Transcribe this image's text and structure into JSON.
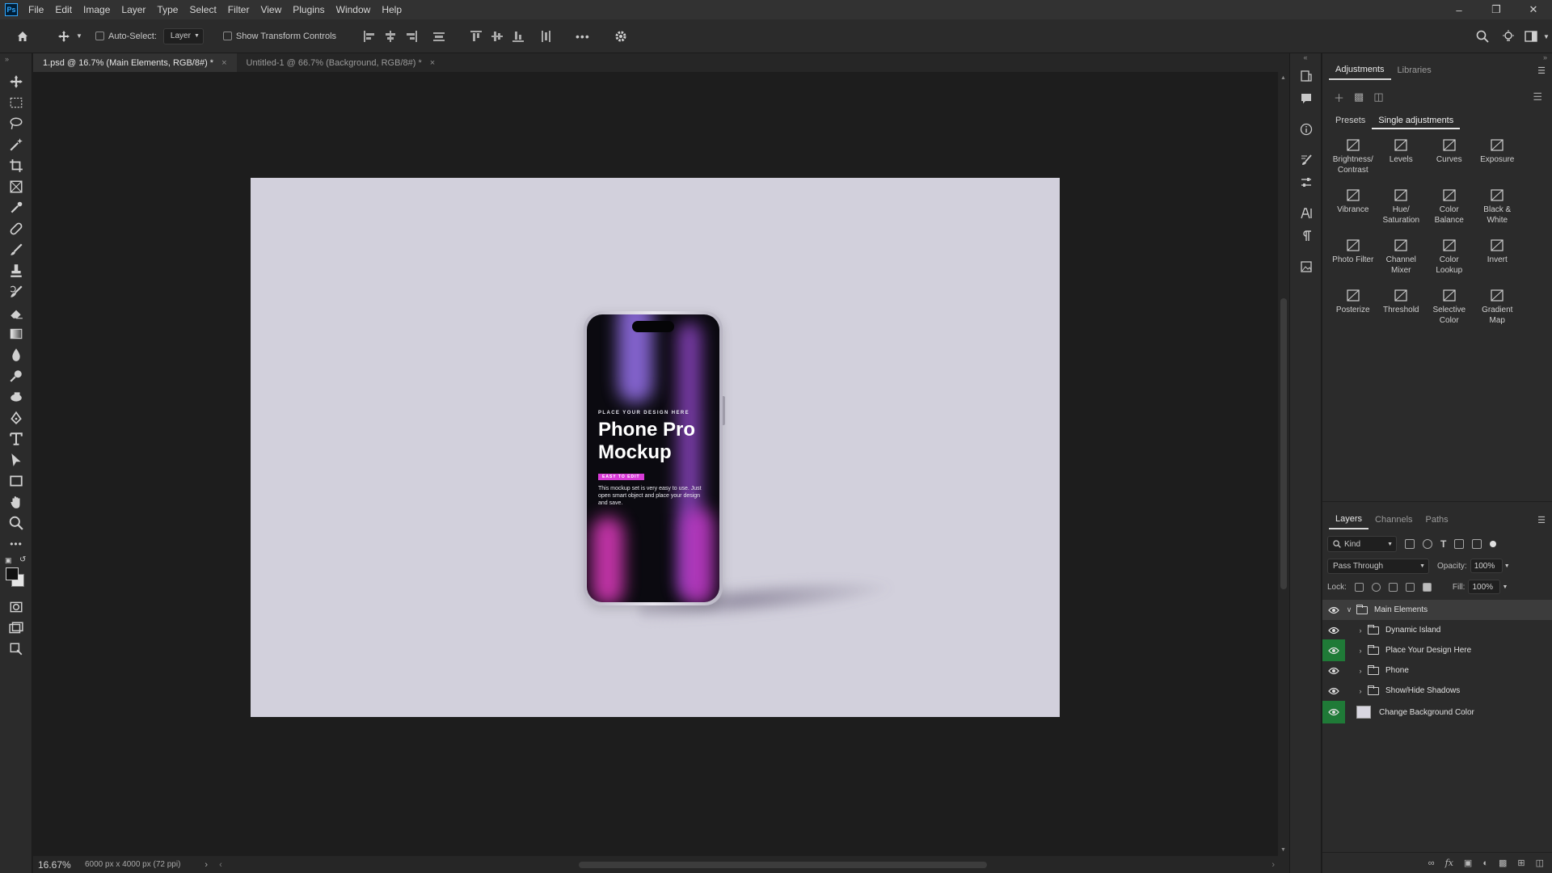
{
  "app": {
    "logo": "Ps"
  },
  "menu": [
    "File",
    "Edit",
    "Image",
    "Layer",
    "Type",
    "Select",
    "Filter",
    "View",
    "Plugins",
    "Window",
    "Help"
  ],
  "options": {
    "auto_select": "Auto-Select:",
    "target": "Layer",
    "show_transform": "Show Transform Controls",
    "more": "•••"
  },
  "tabs": [
    {
      "label": "1.psd @ 16.7% (Main Elements, RGB/8#) *",
      "close": "×"
    },
    {
      "label": "Untitled-1 @ 66.7% (Background, RGB/8#) *",
      "close": "×"
    }
  ],
  "canvas": {
    "background": "#d2d0dc",
    "phone": {
      "kicker": "PLACE YOUR DESIGN HERE",
      "title": "Phone Pro Mockup",
      "badge": "EASY TO EDIT",
      "body": "This mockup set is very easy to use. Just open smart object and place your design and save."
    }
  },
  "status": {
    "zoom": "16.67%",
    "doc_info": "6000 px x 4000 px (72 ppi)"
  },
  "adjustments": {
    "tabs": [
      "Adjustments",
      "Libraries"
    ],
    "subtabs": [
      "Presets",
      "Single adjustments"
    ],
    "items": [
      [
        "Brightness/",
        "Contrast"
      ],
      [
        "Levels",
        ""
      ],
      [
        "Curves",
        ""
      ],
      [
        "Exposure",
        ""
      ],
      [
        "Vibrance",
        ""
      ],
      [
        "Hue/",
        "Saturation"
      ],
      [
        "Color",
        "Balance"
      ],
      [
        "Black &",
        "White"
      ],
      [
        "Photo Filter",
        ""
      ],
      [
        "Channel",
        "Mixer"
      ],
      [
        "Color",
        "Lookup"
      ],
      [
        "Invert",
        ""
      ],
      [
        "Posterize",
        ""
      ],
      [
        "Threshold",
        ""
      ],
      [
        "Selective",
        "Color"
      ],
      [
        "Gradient",
        "Map"
      ]
    ]
  },
  "layers": {
    "tabs": [
      "Layers",
      "Channels",
      "Paths"
    ],
    "kind": "Kind",
    "blend": "Pass Through",
    "opacity_label": "Opacity:",
    "opacity": "100%",
    "lock_label": "Lock:",
    "fill_label": "Fill:",
    "fill": "100%",
    "items": [
      {
        "name": "Main Elements"
      },
      {
        "name": "Dynamic Island"
      },
      {
        "name": "Place Your Design Here"
      },
      {
        "name": "Phone"
      },
      {
        "name": "Show/Hide Shadows"
      },
      {
        "name": "Change Background Color"
      }
    ]
  }
}
